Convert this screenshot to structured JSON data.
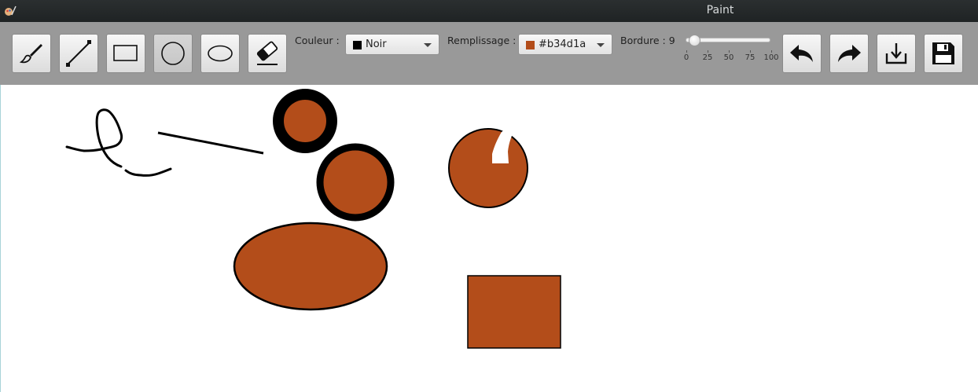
{
  "window": {
    "title": "Paint"
  },
  "toolbar": {
    "tools": [
      {
        "name": "brush-tool",
        "icon": "brush-icon",
        "active": false
      },
      {
        "name": "line-tool",
        "icon": "line-icon",
        "active": false
      },
      {
        "name": "rectangle-tool",
        "icon": "rectangle-icon",
        "active": false
      },
      {
        "name": "circle-tool",
        "icon": "circle-icon",
        "active": true
      },
      {
        "name": "ellipse-tool",
        "icon": "ellipse-icon",
        "active": false
      },
      {
        "name": "eraser-tool",
        "icon": "eraser-icon",
        "active": false
      }
    ],
    "color_label": "Couleur :",
    "color_value": "Noir",
    "color_swatch": "#000000",
    "fill_label": "Remplissage :",
    "fill_value": "#b34d1a",
    "fill_swatch": "#b34d1a",
    "border_label": "Bordure : 9",
    "border_value": 9,
    "slider_ticks": [
      "0",
      "25",
      "50",
      "75",
      "100"
    ],
    "actions": [
      {
        "name": "undo-button",
        "icon": "undo-icon"
      },
      {
        "name": "redo-button",
        "icon": "redo-icon"
      },
      {
        "name": "export-button",
        "icon": "download-icon"
      },
      {
        "name": "save-button",
        "icon": "floppy-disk-icon"
      }
    ]
  },
  "colors": {
    "fill": "#b34d1a",
    "stroke": "#000000",
    "toolbar_bg": "#999999",
    "titlebar_bg": "#1f2324"
  }
}
